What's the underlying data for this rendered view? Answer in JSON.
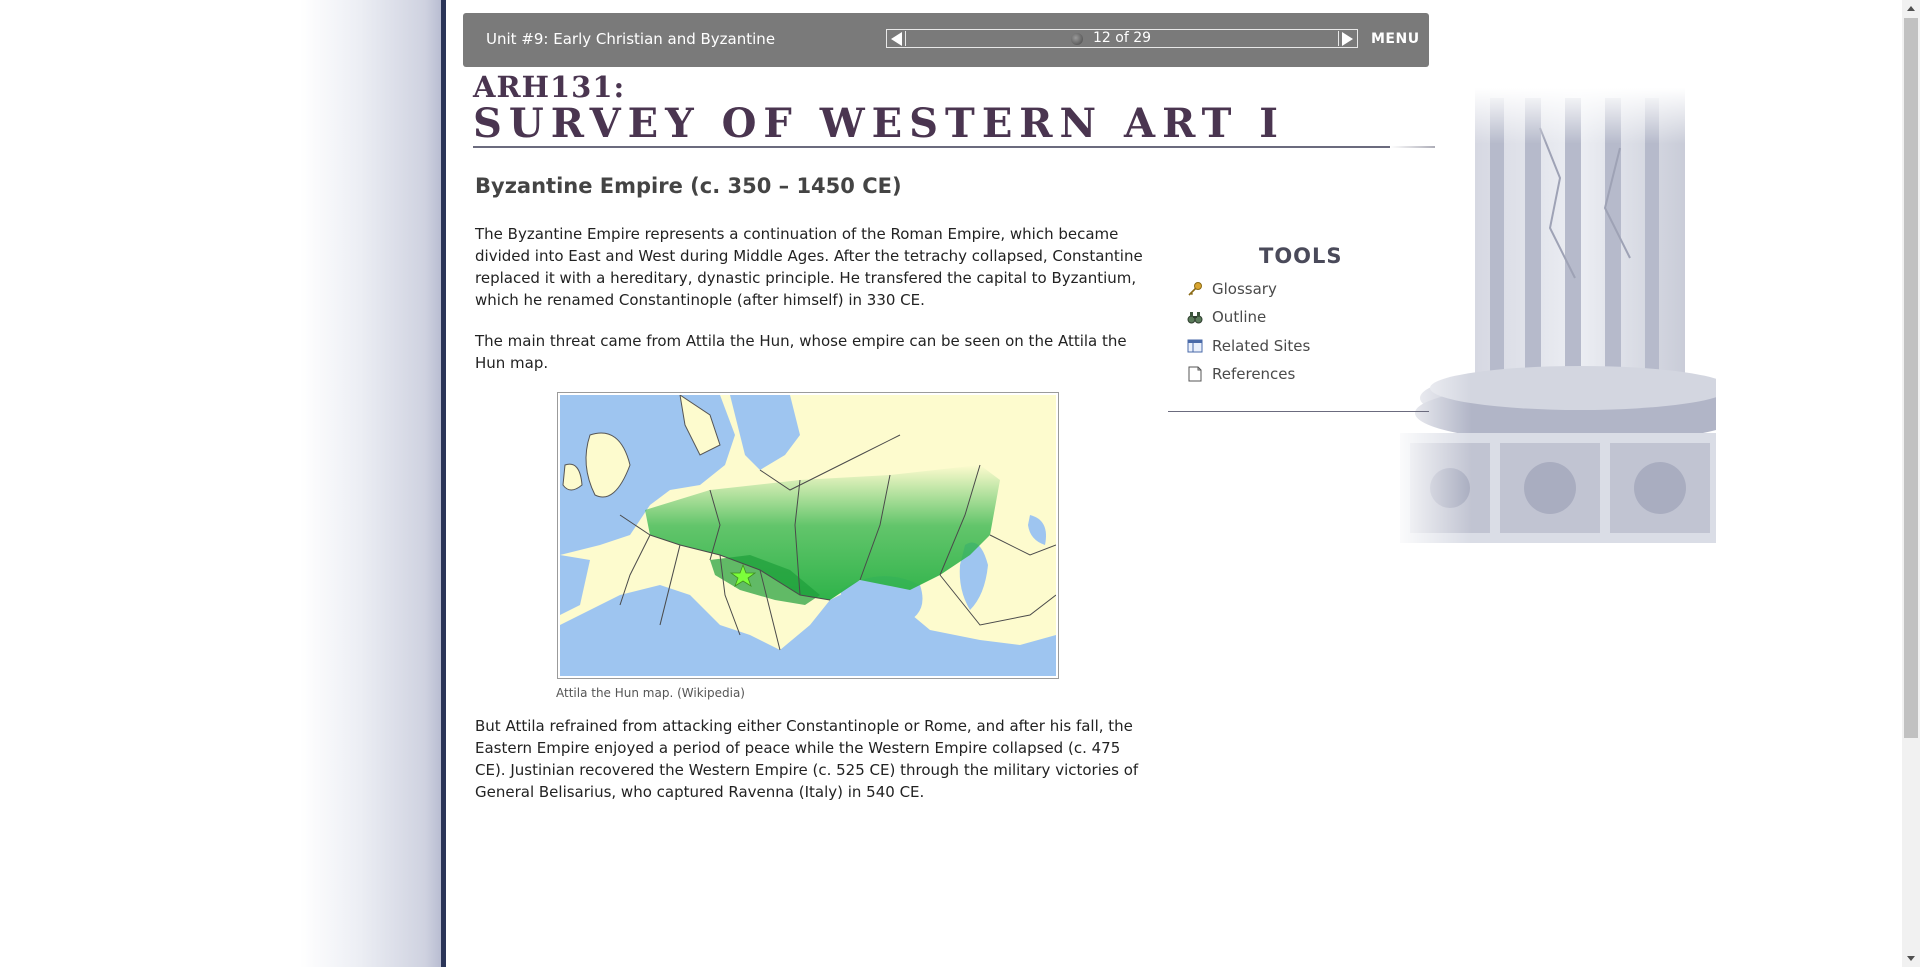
{
  "topbar": {
    "unit_title": "Unit #9: Early Christian and Byzantine",
    "page_count": "12 of 29",
    "menu_label": "MENU"
  },
  "course": {
    "code": "ARH131:",
    "name": "SURVEY OF WESTERN ART I"
  },
  "main": {
    "title": "Byzantine Empire (c. 350 – 1450 CE)",
    "para1": "The Byzantine Empire represents a continuation of the Roman Empire, which became divided into East and West during Middle Ages. After the tetrachy collapsed, Constantine replaced it with a hereditary, dynastic principle. He transfered the capital to Byzantium, which he renamed Constantinople (after himself) in 330 CE.",
    "para2": "The main threat came from Attila the Hun, whose empire can be seen on the Attila the Hun map.",
    "map_caption": "Attila the Hun map. (Wikipedia)",
    "para3": "But Attila refrained from attacking either Constantinople or Rome, and after his fall, the Eastern Empire enjoyed a period of peace while the Western Empire collapsed (c. 475 CE). Justinian recovered the Western Empire (c. 525 CE) through the military victories of General Belisarius, who captured Ravenna (Italy) in 540 CE."
  },
  "tools": {
    "title": "TOOLS",
    "items": [
      {
        "label": "Glossary",
        "icon": "key-icon"
      },
      {
        "label": "Outline",
        "icon": "binoculars-icon"
      },
      {
        "label": "Related Sites",
        "icon": "window-icon"
      },
      {
        "label": "References",
        "icon": "document-icon"
      }
    ]
  },
  "colors": {
    "topbar": "#7a7a7a",
    "navy_rule": "#2b3558",
    "title_purple": "#4a3550",
    "map_sea": "#9ec5f0",
    "map_land": "#fdfbce",
    "map_empire": "#2fb34a"
  }
}
